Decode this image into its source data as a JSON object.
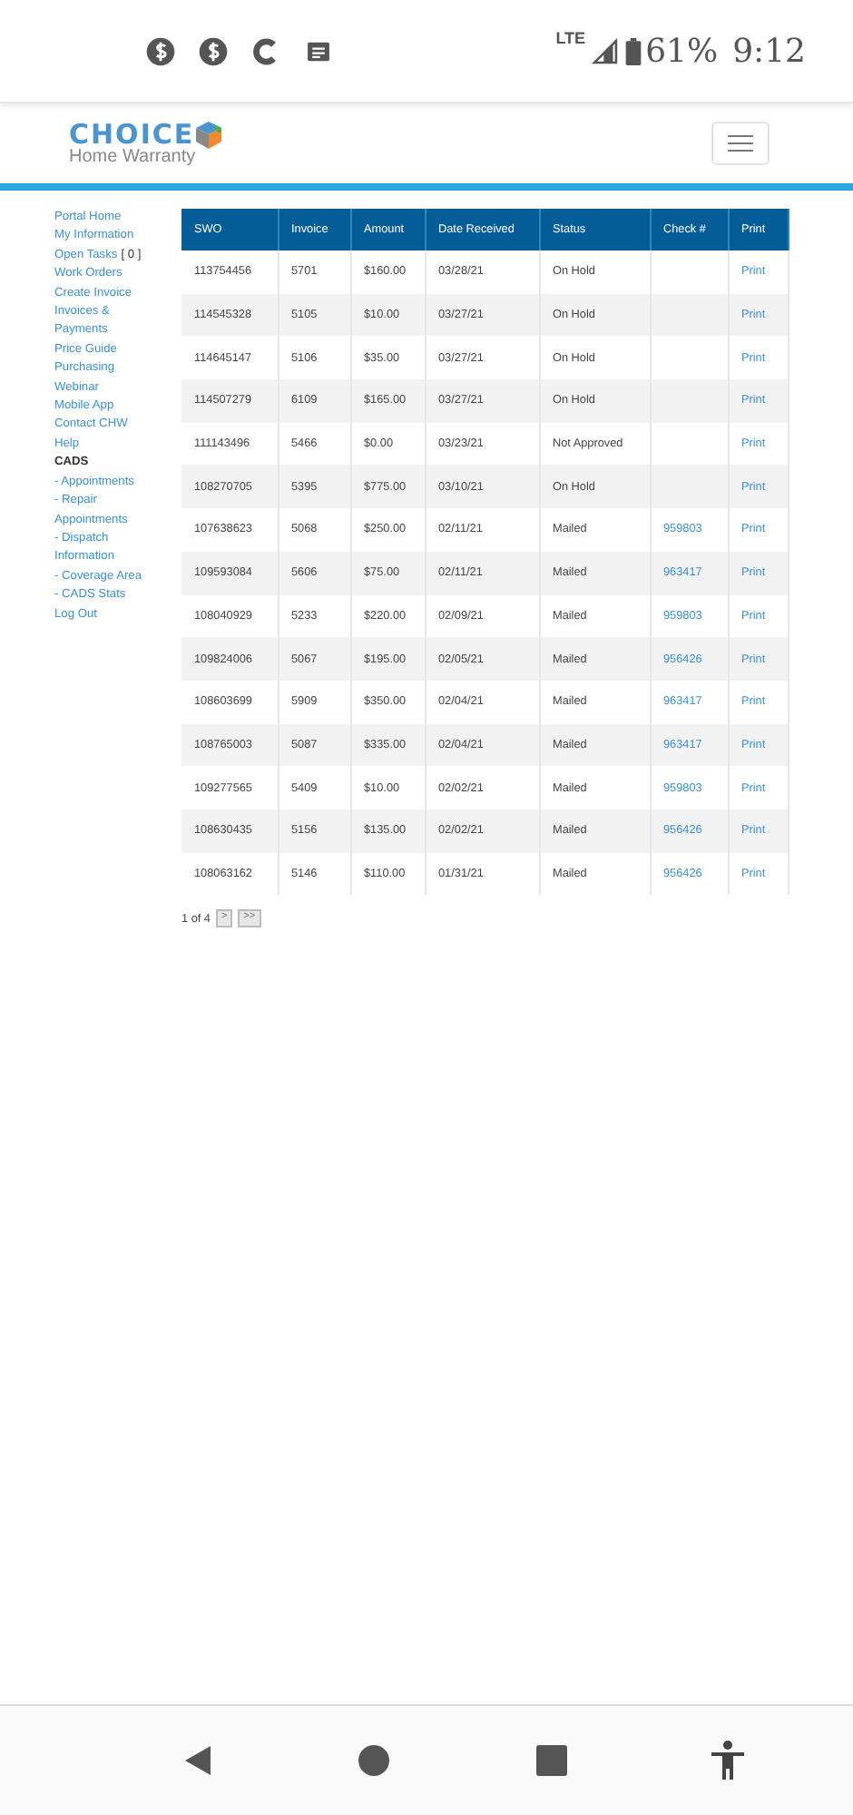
{
  "status_bar": {
    "network": "LTE",
    "battery": "61%",
    "time": "9:12"
  },
  "header": {
    "logo_word": "CHOICE",
    "logo_sub": "Home Warranty"
  },
  "sidebar": {
    "items": [
      {
        "kind": "link",
        "label": "Portal Home"
      },
      {
        "kind": "link",
        "label": "My Information"
      },
      {
        "kind": "link",
        "label": "Open Tasks",
        "count": "[ 0 ]"
      },
      {
        "kind": "link",
        "label": "Work Orders"
      },
      {
        "kind": "link",
        "label": "Create Invoice"
      },
      {
        "kind": "link",
        "label": "Invoices & Payments"
      },
      {
        "kind": "link",
        "label": "Price Guide"
      },
      {
        "kind": "link",
        "label": "Purchasing"
      },
      {
        "kind": "link",
        "label": "Webinar"
      },
      {
        "kind": "link",
        "label": "Mobile App"
      },
      {
        "kind": "link",
        "label": "Contact CHW"
      },
      {
        "kind": "link",
        "label": "Help"
      },
      {
        "kind": "heading",
        "label": "CADS"
      },
      {
        "kind": "link",
        "label": "- Appointments"
      },
      {
        "kind": "link",
        "label": "- Repair Appointments"
      },
      {
        "kind": "link",
        "label": "- Dispatch Information"
      },
      {
        "kind": "link",
        "label": "- Coverage Area"
      },
      {
        "kind": "link",
        "label": "- CADS Stats"
      },
      {
        "kind": "link",
        "label": "Log Out"
      }
    ]
  },
  "table": {
    "columns": [
      "SWO",
      "Invoice",
      "Amount",
      "Date Received",
      "Status",
      "Check #",
      "Print"
    ],
    "rows": [
      {
        "swo": "113754456",
        "invoice": "5701",
        "amount": "$160.00",
        "date": "03/28/21",
        "status": "On Hold",
        "check": "",
        "print": "Print"
      },
      {
        "swo": "114545328",
        "invoice": "5105",
        "amount": "$10.00",
        "date": "03/27/21",
        "status": "On Hold",
        "check": "",
        "print": "Print"
      },
      {
        "swo": "114645147",
        "invoice": "5106",
        "amount": "$35.00",
        "date": "03/27/21",
        "status": "On Hold",
        "check": "",
        "print": "Print"
      },
      {
        "swo": "114507279",
        "invoice": "6109",
        "amount": "$165.00",
        "date": "03/27/21",
        "status": "On Hold",
        "check": "",
        "print": "Print"
      },
      {
        "swo": "111143496",
        "invoice": "5466",
        "amount": "$0.00",
        "date": "03/23/21",
        "status": "Not Approved",
        "check": "",
        "print": "Print"
      },
      {
        "swo": "108270705",
        "invoice": "5395",
        "amount": "$775.00",
        "date": "03/10/21",
        "status": "On Hold",
        "check": "",
        "print": "Print"
      },
      {
        "swo": "107638623",
        "invoice": "5068",
        "amount": "$250.00",
        "date": "02/11/21",
        "status": "Mailed",
        "check": "959803",
        "print": "Print"
      },
      {
        "swo": "109593084",
        "invoice": "5606",
        "amount": "$75.00",
        "date": "02/11/21",
        "status": "Mailed",
        "check": "963417",
        "print": "Print"
      },
      {
        "swo": "108040929",
        "invoice": "5233",
        "amount": "$220.00",
        "date": "02/09/21",
        "status": "Mailed",
        "check": "959803",
        "print": "Print"
      },
      {
        "swo": "109824006",
        "invoice": "5067",
        "amount": "$195.00",
        "date": "02/05/21",
        "status": "Mailed",
        "check": "956426",
        "print": "Print"
      },
      {
        "swo": "108603699",
        "invoice": "5909",
        "amount": "$350.00",
        "date": "02/04/21",
        "status": "Mailed",
        "check": "963417",
        "print": "Print"
      },
      {
        "swo": "108765003",
        "invoice": "5087",
        "amount": "$335.00",
        "date": "02/04/21",
        "status": "Mailed",
        "check": "963417",
        "print": "Print"
      },
      {
        "swo": "109277565",
        "invoice": "5409",
        "amount": "$10.00",
        "date": "02/02/21",
        "status": "Mailed",
        "check": "959803",
        "print": "Print"
      },
      {
        "swo": "108630435",
        "invoice": "5156",
        "amount": "$135.00",
        "date": "02/02/21",
        "status": "Mailed",
        "check": "956426",
        "print": "Print"
      },
      {
        "swo": "108063162",
        "invoice": "5146",
        "amount": "$110.00",
        "date": "01/31/21",
        "status": "Mailed",
        "check": "956426",
        "print": "Print"
      }
    ]
  },
  "pagination": {
    "label": "1 of 4",
    "next": ">",
    "last": ">>"
  }
}
